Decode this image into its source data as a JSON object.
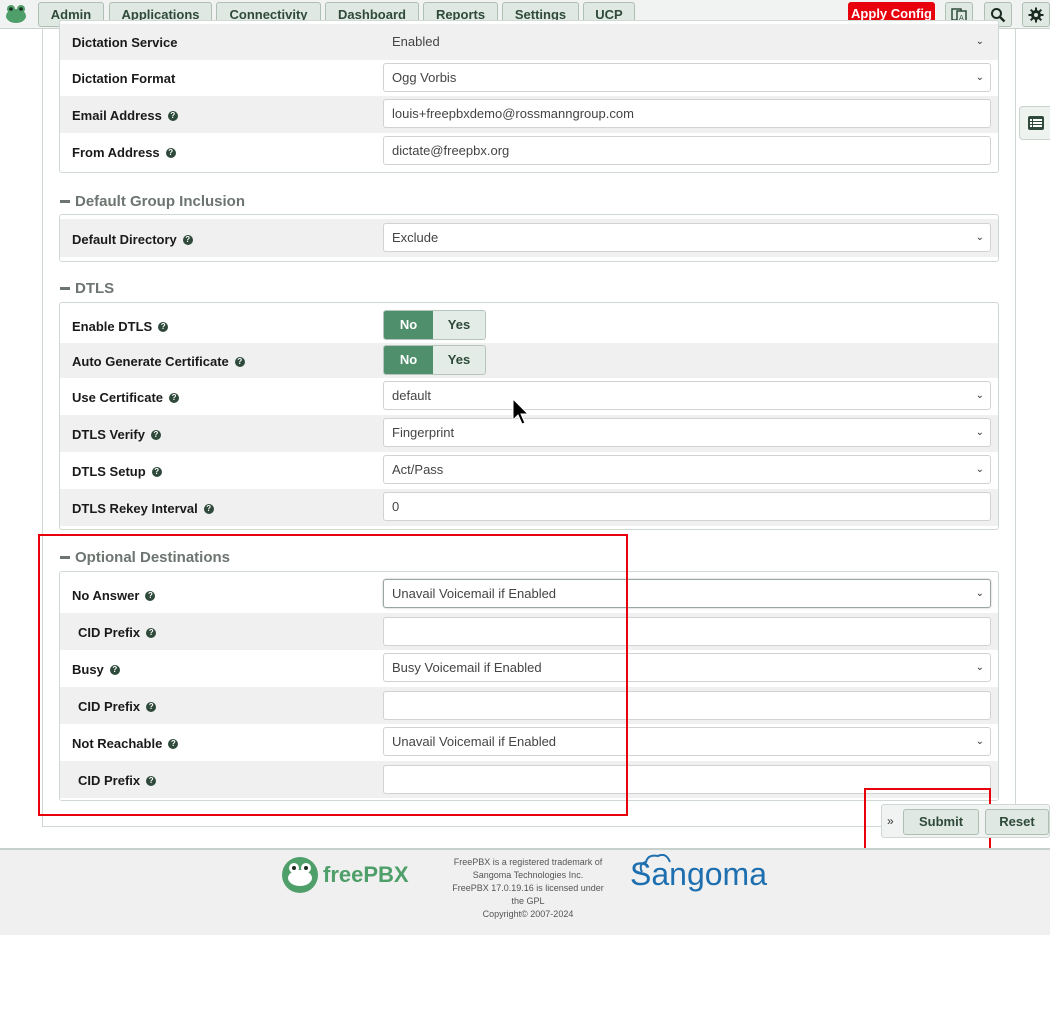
{
  "nav": {
    "items": [
      "Admin",
      "Applications",
      "Connectivity",
      "Dashboard",
      "Reports",
      "Settings",
      "UCP"
    ],
    "apply_label": "Apply Config",
    "icons": [
      "frog-logo-icon",
      "language-icon",
      "search-icon",
      "gear-icon"
    ]
  },
  "top_rows": [
    {
      "label": "Dictation Service",
      "value": "Enabled",
      "type": "select",
      "help": false
    },
    {
      "label": "Dictation Format",
      "value": "Ogg Vorbis",
      "type": "select",
      "help": false
    },
    {
      "label": "Email Address",
      "value": "louis+freepbxdemo@rossmanngroup.com",
      "type": "input",
      "help": true
    },
    {
      "label": "From Address",
      "value": "dictate@freepbx.org",
      "type": "input",
      "help": true
    }
  ],
  "group_inclusion": {
    "title": "Default Group Inclusion",
    "rows": [
      {
        "label": "Default Directory",
        "value": "Exclude"
      }
    ]
  },
  "dtls": {
    "title": "DTLS",
    "enable": {
      "label": "Enable DTLS",
      "no": "No",
      "yes": "Yes"
    },
    "autogen": {
      "label": "Auto Generate Certificate",
      "no": "No",
      "yes": "Yes"
    },
    "rows": [
      {
        "label": "Use Certificate",
        "value": "default"
      },
      {
        "label": "DTLS Verify",
        "value": "Fingerprint"
      },
      {
        "label": "DTLS Setup",
        "value": "Act/Pass"
      },
      {
        "label": "DTLS Rekey Interval",
        "value": "0"
      }
    ]
  },
  "optional": {
    "title": "Optional Destinations",
    "no_answer": {
      "label": "No Answer",
      "value": "Unavail Voicemail if Enabled"
    },
    "cid1": {
      "label": "CID Prefix",
      "value": ""
    },
    "busy": {
      "label": "Busy",
      "value": "Busy Voicemail if Enabled"
    },
    "cid2": {
      "label": "CID Prefix",
      "value": ""
    },
    "not_reachable": {
      "label": "Not Reachable",
      "value": "Unavail Voicemail if Enabled"
    },
    "cid3": {
      "label": "CID Prefix",
      "value": ""
    }
  },
  "actions": {
    "submit": "Submit",
    "reset": "Reset"
  },
  "footer": {
    "brand": "freePBX",
    "line1": "FreePBX is a registered trademark of",
    "line2": "Sangoma Technologies Inc.",
    "line3": "FreePBX 17.0.19.16 is licensed under",
    "line4": "the GPL",
    "line5": "Copyright© 2007-2024",
    "sangoma": "Sangoma"
  },
  "colors": {
    "accent": "#4f8f6c",
    "apply": "#e8000d",
    "highlight": "#e8000d"
  }
}
